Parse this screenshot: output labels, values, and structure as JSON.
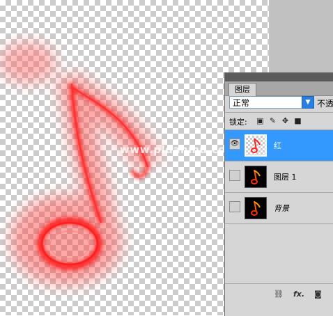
{
  "panel": {
    "tab_label": "图层",
    "blend_mode": "正常",
    "opacity_label": "不透",
    "lock_label": "锁定:",
    "lock_icons": [
      "lock-transparent-icon",
      "lock-paint-icon",
      "lock-move-icon",
      "lock-all-icon"
    ],
    "layers": [
      {
        "name": "红",
        "visible": true,
        "selected": true,
        "thumbnail": "transparent-with-red-note"
      },
      {
        "name": "图层 1",
        "visible": false,
        "selected": false,
        "thumbnail": "black-with-fire-note"
      },
      {
        "name": "背景",
        "visible": false,
        "selected": false,
        "thumbnail": "black-with-fire-note"
      }
    ],
    "footer_icons": [
      "link-layers-icon",
      "fx-icon",
      "add-mask-icon"
    ],
    "fx_label": "fx."
  },
  "canvas": {
    "watermark": "www.pldanmu.com"
  },
  "colors": {
    "selected_row": "#3399ff",
    "note_red": "#ff1a1a",
    "canvas_gray": "#c1c1c1"
  }
}
